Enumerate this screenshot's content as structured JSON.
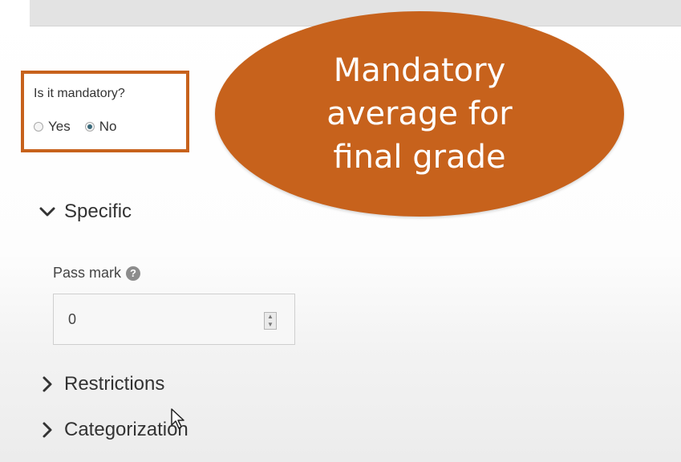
{
  "mandatory": {
    "question": "Is it mandatory?",
    "option_yes": "Yes",
    "option_no": "No",
    "selected": "No"
  },
  "callout": {
    "text_line1": "Mandatory",
    "text_line2": "average for",
    "text_line3": "final grade"
  },
  "sections": {
    "specific_label": "Specific",
    "restrictions_label": "Restrictions",
    "categorization_label": "Categorization"
  },
  "pass_mark": {
    "label": "Pass mark",
    "value": "0",
    "help_icon": "question-circle-icon"
  },
  "colors": {
    "accent": "#c7621c"
  }
}
